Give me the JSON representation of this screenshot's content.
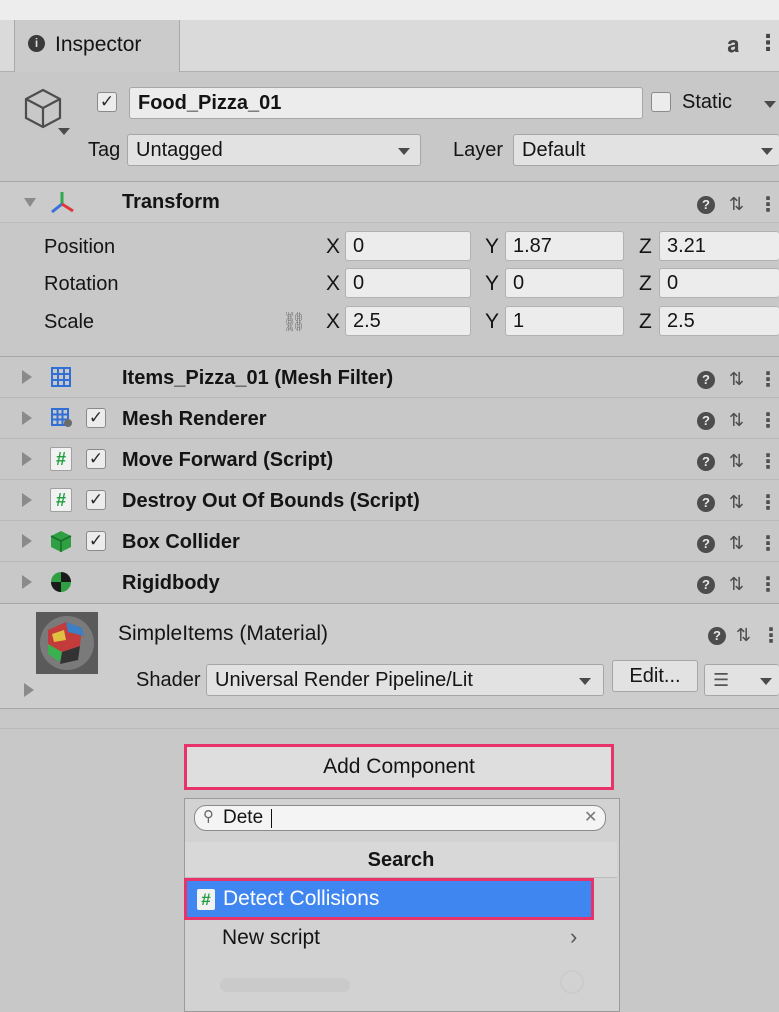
{
  "window": {
    "tab_title": "Inspector"
  },
  "object": {
    "name": "Food_Pizza_01",
    "static_label": "Static",
    "tag_label": "Tag",
    "tag_value": "Untagged",
    "layer_label": "Layer",
    "layer_value": "Default"
  },
  "transform": {
    "title": "Transform",
    "position_label": "Position",
    "rotation_label": "Rotation",
    "scale_label": "Scale",
    "axis_x": "X",
    "axis_y": "Y",
    "axis_z": "Z",
    "position": {
      "x": "0",
      "y": "1.87",
      "z": "3.21"
    },
    "rotation": {
      "x": "0",
      "y": "0",
      "z": "0"
    },
    "scale": {
      "x": "2.5",
      "y": "1",
      "z": "2.5"
    }
  },
  "components": [
    {
      "label": "Items_Pizza_01 (Mesh Filter)",
      "icon": "grid-icon"
    },
    {
      "label": "Mesh Renderer",
      "icon": "mesh-renderer-icon"
    },
    {
      "label": "Move Forward (Script)",
      "icon": "script-icon"
    },
    {
      "label": "Destroy Out Of Bounds (Script)",
      "icon": "script-icon"
    },
    {
      "label": "Box Collider",
      "icon": "box-collider-icon"
    },
    {
      "label": "Rigidbody",
      "icon": "rigidbody-icon"
    }
  ],
  "material": {
    "name": "SimpleItems (Material)",
    "shader_label": "Shader",
    "shader_value": "Universal Render Pipeline/Lit",
    "edit_label": "Edit..."
  },
  "add_component": {
    "button_label": "Add Component",
    "search_value": "Dete",
    "section_header": "Search",
    "results": [
      "Detect Collisions",
      "New script"
    ]
  },
  "colors": {
    "selection": "#3f86f0",
    "highlight": "#e8326a",
    "script_icon": "#22a040"
  }
}
